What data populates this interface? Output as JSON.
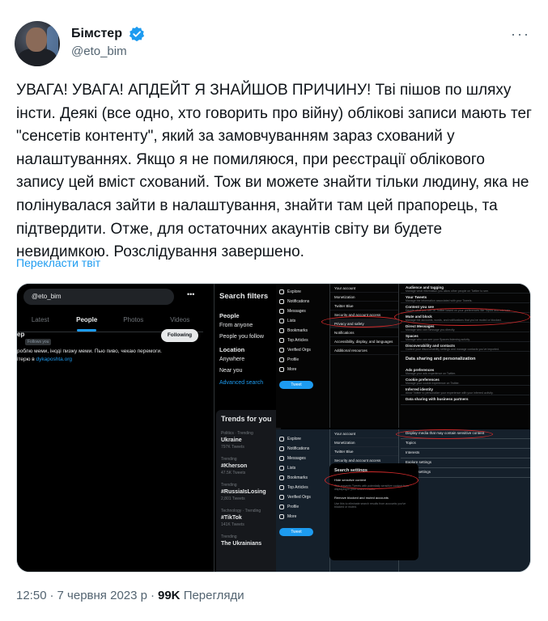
{
  "author": {
    "name": "Бімстер",
    "handle": "@eto_bim"
  },
  "tweet": {
    "text": "УВАГА! УВАГА! АПДЕЙТ Я ЗНАЙШОВ ПРИЧИНУ! Тві пішов по шляху інсти. Деякі (все одно, хто говорить про війну) облікові записи мають тег \"сенсетів контенту\", який за замовчуванням зараз схований у налаштуваннях. Якщо я не помиляюся, при реєстрації облікового запису цей вміст схований. Тож ви можете знайти тільки людину, яка не полінувалася зайти в налаштування, знайти там цей прапорець, та підтвердити. Отже, для остаточних акаунтів світу ви будете невидимкою. Розслідування завершено.",
    "translate_label": "Перекласти твіт"
  },
  "footer": {
    "time": "12:50",
    "date": "7 червня 2023 р",
    "views_count": "99K",
    "views_label": "Перегляди"
  },
  "media": {
    "left": {
      "search_value": "@eto_bim",
      "tabs": [
        "Latest",
        "People",
        "Photos",
        "Videos"
      ],
      "active_tab": "People",
      "profile_name": "ер",
      "follows_you": "Follows you",
      "bio_line1": "роблю меми, іноді пизжу меми. Пью пиво, чекаю перемоги.",
      "bio_line2_prefix": "ітерю в ",
      "bio_line2_link": "dykaposhta.org",
      "following_button": "Following",
      "filters": {
        "title": "Search filters",
        "people_header": "People",
        "people_options": [
          "From anyone",
          "People you follow"
        ],
        "location_header": "Location",
        "location_options": [
          "Anywhere",
          "Near you"
        ],
        "advanced": "Advanced search"
      },
      "trends": {
        "title": "Trends for you",
        "items": [
          {
            "category": "Politics · Trending",
            "name": "Ukraine",
            "count": "797K Tweets"
          },
          {
            "category": "Trending",
            "name": "#Kherson",
            "count": "47.5K Tweets"
          },
          {
            "category": "Trending",
            "name": "#RussiaIsLosing",
            "count": "2,801 Tweets"
          },
          {
            "category": "Technology · Trending",
            "name": "#TikTok",
            "count": "141K Tweets"
          },
          {
            "category": "Trending",
            "name": "The Ukrainians",
            "count": ""
          }
        ]
      }
    },
    "top_right": {
      "nav": [
        "Explore",
        "Notifications",
        "Messages",
        "Lists",
        "Bookmarks",
        "Top Articles",
        "Verified Orgs",
        "Profile",
        "More"
      ],
      "tweet_button": "Tweet",
      "menu": [
        "Your account",
        "Monetization",
        "Twitter Blue",
        "Security and account access",
        "Privacy and safety",
        "Notifications",
        "Accessibility, display, and languages",
        "Additional resources"
      ],
      "selected_menu": "Privacy and safety",
      "details": [
        {
          "label": "Audience and tagging",
          "desc": "Manage what information you allow other people on Twitter to see."
        },
        {
          "label": "Your Tweets",
          "desc": "Manage the information associated with your Tweets."
        },
        {
          "label": "Content you see",
          "desc": "Decide what you see on Twitter based on your preferences like Topics and interests."
        },
        {
          "label": "Mute and block",
          "desc": "Manage the accounts, words, and notifications that you've muted or blocked."
        },
        {
          "label": "Direct Messages",
          "desc": "Manage who can message you directly."
        },
        {
          "label": "Spaces",
          "desc": "Manage who can see your Spaces listening activity."
        },
        {
          "label": "Discoverability and contacts",
          "desc": "Control your discoverability settings and manage contacts you've imported."
        }
      ],
      "section_header": "Data sharing and personalization",
      "details2": [
        {
          "label": "Ads preferences",
          "desc": "Manage your ads experience on Twitter."
        },
        {
          "label": "Cookie preferences",
          "desc": "Manage your cookie experience on Twitter."
        },
        {
          "label": "Inferred identity",
          "desc": "Allow Twitter to personalize your experience with your inferred activity."
        },
        {
          "label": "Data sharing with business partners",
          "desc": ""
        }
      ]
    },
    "bottom_right": {
      "nav": [
        "Explore",
        "Notifications",
        "Messages",
        "Lists",
        "Bookmarks",
        "Top Articles",
        "Verified Orgs",
        "Profile",
        "More"
      ],
      "tweet_button": "Tweet",
      "menu": [
        "Your account",
        "Monetization",
        "Twitter Blue",
        "Security and account access",
        "Privacy and safety",
        "Notifications",
        "Accessibility, display, and languages",
        "Additional resources"
      ],
      "right_items": [
        "Display media that may contain sensitive content",
        "Topics",
        "Interests",
        "Explore settings",
        "Search settings"
      ],
      "modal": {
        "title": "Search settings",
        "option1_label": "Hide sensitive content",
        "option1_desc": "This prevents Tweets with potentially sensitive content from displaying in your search results.",
        "option2_label": "Remove blocked and muted accounts",
        "option2_desc": "Use this to eliminate search results from accounts you've blocked or muted."
      }
    }
  }
}
